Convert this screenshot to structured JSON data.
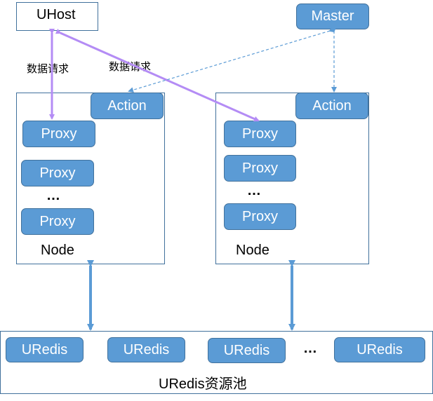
{
  "uhost": {
    "label": "UHost"
  },
  "master": {
    "label": "Master"
  },
  "request_labels": [
    "数据请求",
    "数据请求"
  ],
  "nodes": [
    {
      "label": "Node",
      "action": "Action",
      "proxies": [
        "Proxy",
        "Proxy",
        "Proxy"
      ],
      "ellipsis": "…"
    },
    {
      "label": "Node",
      "action": "Action",
      "proxies": [
        "Proxy",
        "Proxy",
        "Proxy"
      ],
      "ellipsis": "…"
    }
  ],
  "pool": {
    "label": "URedis资源池",
    "instances": [
      "URedis",
      "URedis",
      "URedis",
      "URedis"
    ],
    "ellipsis": "…"
  },
  "colors": {
    "box_fill": "#5b9bd5",
    "box_border": "#41719c",
    "request_arrow": "#b48cf5",
    "control_arrow": "#5b9bd5"
  }
}
